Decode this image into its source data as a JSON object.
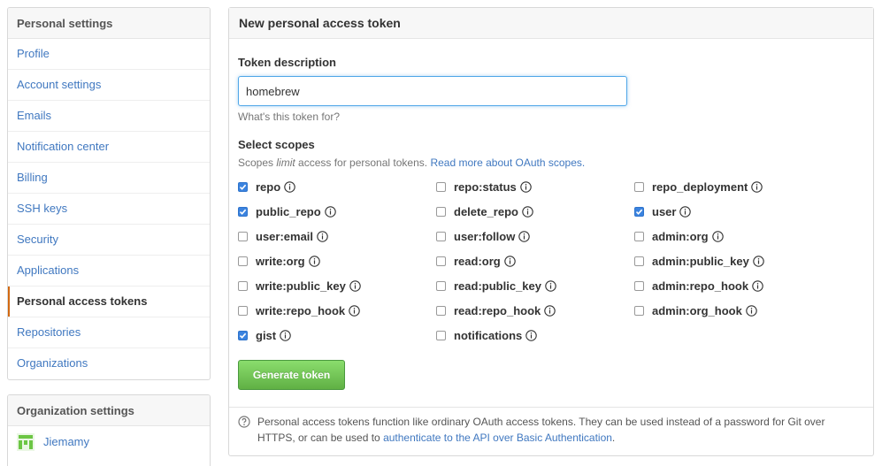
{
  "sidebar": {
    "heading": "Personal settings",
    "items": [
      {
        "label": "Profile"
      },
      {
        "label": "Account settings"
      },
      {
        "label": "Emails"
      },
      {
        "label": "Notification center"
      },
      {
        "label": "Billing"
      },
      {
        "label": "SSH keys"
      },
      {
        "label": "Security"
      },
      {
        "label": "Applications"
      },
      {
        "label": "Personal access tokens"
      },
      {
        "label": "Repositories"
      },
      {
        "label": "Organizations"
      }
    ],
    "selected_index": 8
  },
  "org_sidebar": {
    "heading": "Organization settings",
    "items": [
      {
        "label": "Jiemamy"
      }
    ]
  },
  "main": {
    "title": "New personal access token",
    "token_description_label": "Token description",
    "token_description_value": "homebrew",
    "token_hint": "What's this token for?",
    "scopes_title": "Select scopes",
    "scopes_note_prefix": "Scopes ",
    "scopes_note_em": "limit",
    "scopes_note_middle": " access for personal tokens. ",
    "scopes_note_link": "Read more about OAuth scopes.",
    "scopes": [
      {
        "name": "repo",
        "checked": true
      },
      {
        "name": "repo:status",
        "checked": false
      },
      {
        "name": "repo_deployment",
        "checked": false
      },
      {
        "name": "public_repo",
        "checked": true
      },
      {
        "name": "delete_repo",
        "checked": false
      },
      {
        "name": "user",
        "checked": true
      },
      {
        "name": "user:email",
        "checked": false
      },
      {
        "name": "user:follow",
        "checked": false
      },
      {
        "name": "admin:org",
        "checked": false
      },
      {
        "name": "write:org",
        "checked": false
      },
      {
        "name": "read:org",
        "checked": false
      },
      {
        "name": "admin:public_key",
        "checked": false
      },
      {
        "name": "write:public_key",
        "checked": false
      },
      {
        "name": "read:public_key",
        "checked": false
      },
      {
        "name": "admin:repo_hook",
        "checked": false
      },
      {
        "name": "write:repo_hook",
        "checked": false
      },
      {
        "name": "read:repo_hook",
        "checked": false
      },
      {
        "name": "admin:org_hook",
        "checked": false
      },
      {
        "name": "gist",
        "checked": true
      },
      {
        "name": "notifications",
        "checked": false
      }
    ],
    "generate_button": "Generate token",
    "footer_text": "Personal access tokens function like ordinary OAuth access tokens. They can be used instead of a password for Git over HTTPS, or can be used to ",
    "footer_link": "authenticate to the API over Basic Authentication",
    "footer_end": "."
  },
  "colors": {
    "link": "#4078c0",
    "selected_accent": "#d26911",
    "checkbox_checked": "#3b83df",
    "button_green": "#6cc644",
    "input_focus": "#51a7e8"
  }
}
